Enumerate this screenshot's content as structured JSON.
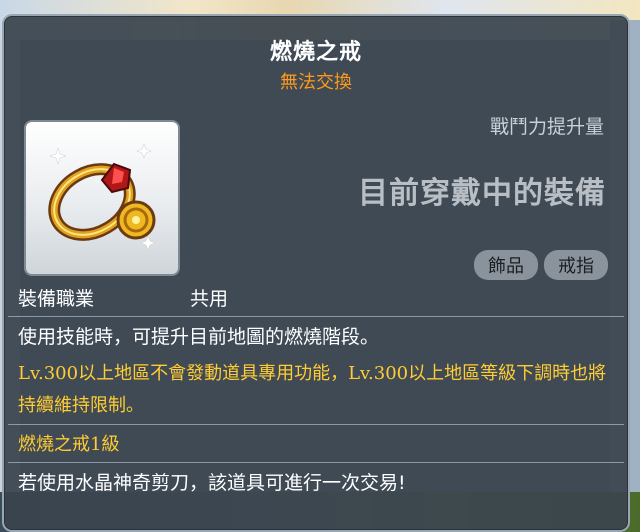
{
  "item": {
    "name": "燃燒之戒",
    "trade_status": "無法交換",
    "power_label": "戰鬥力提升量",
    "equipped_text": "目前穿戴中的裝備",
    "tags": [
      "飾品",
      "戒指"
    ],
    "job_label": "裝備職業",
    "job_value": "共用",
    "description": "使用技能時，可提升目前地圖的燃燒階段。",
    "warning": "Lv.300以上地區不會發動道具專用功能，Lv.300以上地區等級下調時也將持續維持限制。",
    "level_text": "燃燒之戒1級",
    "scissors_text": "若使用水晶神奇剪刀，該道具可進行一次交易!"
  },
  "colors": {
    "tooltip_bg": "#3a444e",
    "title": "#ffffff",
    "trade_status": "#ff9a1a",
    "warning": "#ffcc33",
    "tag_bg": "#8a939b"
  },
  "icons": {
    "item_icon": "ring-icon"
  }
}
